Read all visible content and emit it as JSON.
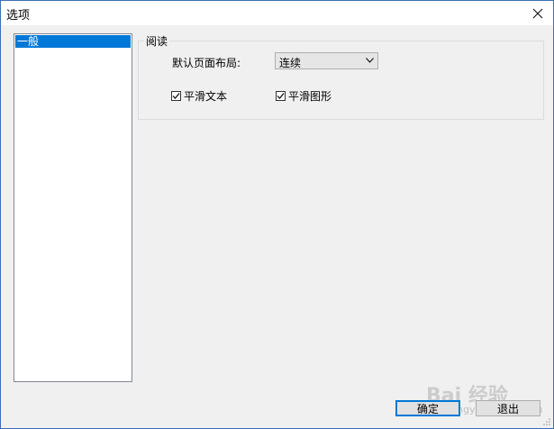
{
  "window": {
    "title": "选项"
  },
  "sidebar": {
    "items": [
      {
        "label": "一般",
        "selected": true
      }
    ]
  },
  "reading_group": {
    "title": "阅读",
    "default_layout_label": "默认页面布局:",
    "default_layout_value": "连续",
    "smooth_text": {
      "label": "平滑文本",
      "checked": true
    },
    "smooth_graphics": {
      "label": "平滑图形",
      "checked": true
    }
  },
  "buttons": {
    "ok": "确定",
    "exit": "退出"
  },
  "watermark": {
    "text": "Bai 经验",
    "sub": "jingyan.baidu.com"
  },
  "colors": {
    "selection": "#0078d7",
    "border_accent": "#3c6eb4"
  }
}
